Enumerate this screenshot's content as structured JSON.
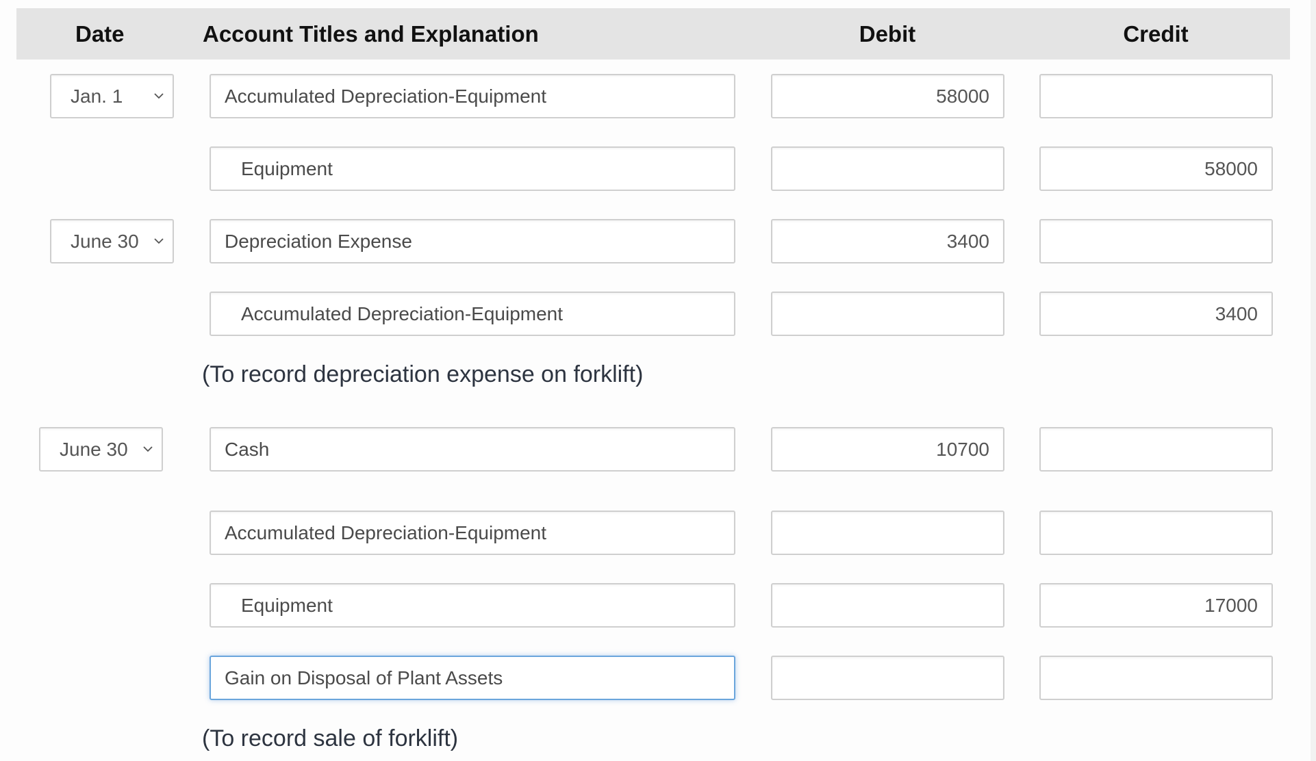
{
  "header": {
    "date": "Date",
    "account": "Account Titles and Explanation",
    "debit": "Debit",
    "credit": "Credit"
  },
  "entries": [
    {
      "date": "Jan. 1",
      "lines": [
        {
          "account": "Accumulated Depreciation-Equipment",
          "debit": "58000",
          "credit": ""
        },
        {
          "account": "Equipment",
          "debit": "",
          "credit": "58000"
        }
      ],
      "explanation": ""
    },
    {
      "date": "June 30",
      "lines": [
        {
          "account": "Depreciation Expense",
          "debit": "3400",
          "credit": ""
        },
        {
          "account": "Accumulated Depreciation-Equipment",
          "debit": "",
          "credit": "3400"
        }
      ],
      "explanation": "(To record depreciation expense on forklift)"
    },
    {
      "date": "June 30",
      "lines": [
        {
          "account": "Cash",
          "debit": "10700",
          "credit": ""
        },
        {
          "account": "Accumulated Depreciation-Equipment",
          "debit": "",
          "credit": ""
        },
        {
          "account": "Equipment",
          "debit": "",
          "credit": "17000"
        },
        {
          "account": "Gain on Disposal of Plant Assets",
          "debit": "",
          "credit": ""
        }
      ],
      "explanation": "(To record sale of forklift)"
    }
  ],
  "icons": {
    "date_dropdown": "chevron-down-icon"
  },
  "colors": {
    "header_bg": "#e4e4e4",
    "focus_border": "#6aa5dc",
    "field_border": "#cfcfcf"
  }
}
